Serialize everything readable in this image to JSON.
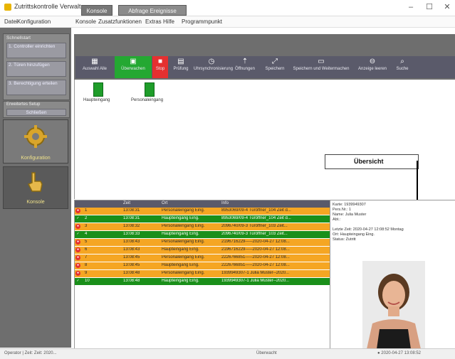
{
  "window": {
    "title": "Zutrittskontrolle Verwaltung",
    "minimize_icon": "minimize-icon",
    "maximize_icon": "maximize-icon",
    "close_icon": "close-icon",
    "minimize_glyph": "–",
    "maximize_glyph": "☐",
    "close_glyph": "✕"
  },
  "menu": [
    "Datei",
    "Konfiguration",
    "Konsole",
    "Zusatzfunktionen",
    "Extras",
    "Hilfe",
    "Programmpunkt"
  ],
  "nav": {
    "group_title": "Schnellstart",
    "links": [
      "1. Controller einrichten",
      "2. Türen hinzufügen",
      "3. Berechtigung erteilen"
    ],
    "group2_title": "Erweitertes Setup",
    "group2_button": "Schließen",
    "config_label": "Konfiguration",
    "console_label": "Konsole"
  },
  "tabs": [
    "Konsole",
    "Abfrage Ereignisse"
  ],
  "toolbar": [
    {
      "label": "Auswahl Alle",
      "icon": "select-all-icon",
      "glyph": "▦"
    },
    {
      "label": "Überwachen",
      "icon": "monitor-icon",
      "glyph": "▣"
    },
    {
      "label": "Stop",
      "icon": "stop-icon",
      "glyph": "■"
    },
    {
      "label": "Prüfung",
      "icon": "check-icon",
      "glyph": "▤"
    },
    {
      "label": "Uhrsynchronisierung",
      "icon": "clock-icon",
      "glyph": "◷"
    },
    {
      "label": "Öffnungen",
      "icon": "open-door-icon",
      "glyph": "⇡"
    },
    {
      "label": "Speichern",
      "icon": "save-icon",
      "glyph": "⤢"
    },
    {
      "label": "Speichern und Weitermachen",
      "icon": "save-continue-icon",
      "glyph": "▭"
    },
    {
      "label": "Anzeige leeren",
      "icon": "clear-display-icon",
      "glyph": "⊖"
    },
    {
      "label": "Suche",
      "icon": "search-icon",
      "glyph": "⌕"
    }
  ],
  "doors": [
    "Haupteingang",
    "Personaleingang"
  ],
  "overview_label": "Übersicht",
  "table": {
    "headers": [
      "",
      "Zeit",
      "Ort",
      "Info"
    ],
    "rows": [
      {
        "n": "1",
        "time": "13:08:31",
        "place": "Personaleingang Eing.",
        "info": "8953069/09-4 Türöffner_104 Zeit d...",
        "status": "warn"
      },
      {
        "n": "2",
        "time": "13:08:31",
        "place": "Haupteingang Eing.",
        "info": "8953069/09-4 Türöffner_104 Zeit d...",
        "status": "ok"
      },
      {
        "n": "3",
        "time": "13:08:32",
        "place": "Personaleingang Eing.",
        "info": "2096740/09-3 Türöffner_103 Zeit...",
        "status": "warn"
      },
      {
        "n": "4",
        "time": "13:08:33",
        "place": "Haupteingang Eing.",
        "info": "2096740/09-3 Türöffner_103 Zeit...",
        "status": "ok"
      },
      {
        "n": "5",
        "time": "13:08:43",
        "place": "Personaleingang Eing.",
        "info": "2196716229-----2020-04-27 12:08...",
        "status": "warn"
      },
      {
        "n": "6",
        "time": "13:08:43",
        "place": "Haupteingang Eing.",
        "info": "2196716229-----2020-04-27 12:08...",
        "status": "warn"
      },
      {
        "n": "7",
        "time": "13:08:45",
        "place": "Personaleingang Eing.",
        "info": "2226766851-----2020-04-27 12:08...",
        "status": "warn"
      },
      {
        "n": "8",
        "time": "13:08:45",
        "place": "Haupteingang Eing.",
        "info": "2226766851-----2020-04-27 12:08...",
        "status": "warn"
      },
      {
        "n": "9",
        "time": "13:08:48",
        "place": "Personaleingang Eing.",
        "info": "1939949307-1 Julia Muster--2020...",
        "status": "warn"
      },
      {
        "n": "10",
        "time": "13:08:48",
        "place": "Haupteingang Eing.",
        "info": "1939949307-1 Julia Muster--2020...",
        "status": "ok"
      }
    ]
  },
  "detail": {
    "lines": [
      "Karte:    1939949307",
      "Pers.Nr.: 1",
      "Name:     Julia Muster",
      "Abt.:",
      "Letzte Zeit:    2020-04-27 12:08:52 Montag",
      "Ort:      Haupteingang Eing.",
      "Status:   Zutritt"
    ]
  },
  "colors": {
    "row_ok": "#1a8f1a",
    "row_warn": "#f5a623",
    "stop_red": "#e53030",
    "monitor_green": "#24a832",
    "nav_bg": "#6e6e6e",
    "toolbar_bg": "#5a5a6a",
    "overview_arrow": "#000000"
  },
  "status": {
    "left": "Operator | Zeit: Zeit: 2020...",
    "middle": "Überwacht",
    "right": "● 2020-04-27 13:08:52"
  }
}
